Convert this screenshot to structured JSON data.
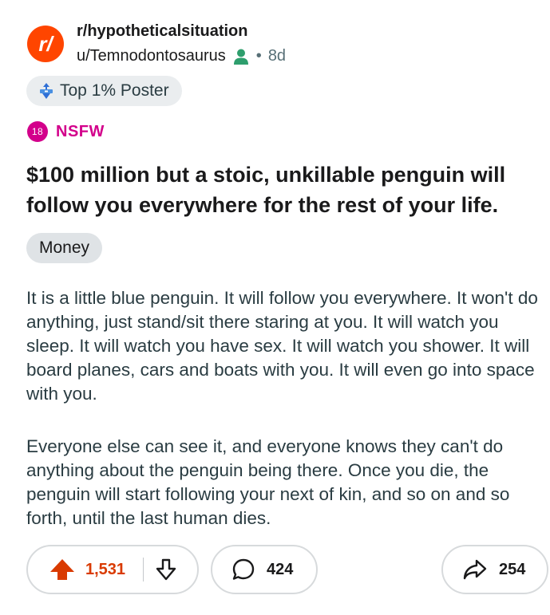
{
  "post": {
    "avatar_letter": "r/",
    "subreddit": "r/hypotheticalsituation",
    "username": "u/Temnodontosaurus",
    "separator": "•",
    "age": "8d",
    "user_flair": "Top 1% Poster",
    "nsfw_badge": "18",
    "nsfw_label": "NSFW",
    "title": "$100 million but a stoic, unkillable penguin will follow you everywhere for the rest of your life.",
    "post_flair": "Money",
    "body": [
      "It is a little blue penguin. It will follow you everywhere. It won't do anything, just stand/sit there staring at you. It will watch you sleep. It will watch you have sex. It will watch you shower. It will board planes, cars and boats with you. It will even go into space with you.",
      "Everyone else can see it, and everyone knows they can't do anything about the penguin being there. Once you die, the penguin will start following your next of kin, and so on and so forth, until the last human dies."
    ]
  },
  "actions": {
    "upvotes": "1,531",
    "comments": "424",
    "shares": "254"
  },
  "colors": {
    "brand": "#ff4500",
    "nsfw": "#d3008b",
    "upvote": "#d93a00",
    "user_icon": "#2e9e6d"
  },
  "icons": [
    "subreddit-avatar-icon",
    "user-icon",
    "top-poster-icon",
    "upvote-icon",
    "downvote-icon",
    "comment-icon",
    "share-icon"
  ]
}
